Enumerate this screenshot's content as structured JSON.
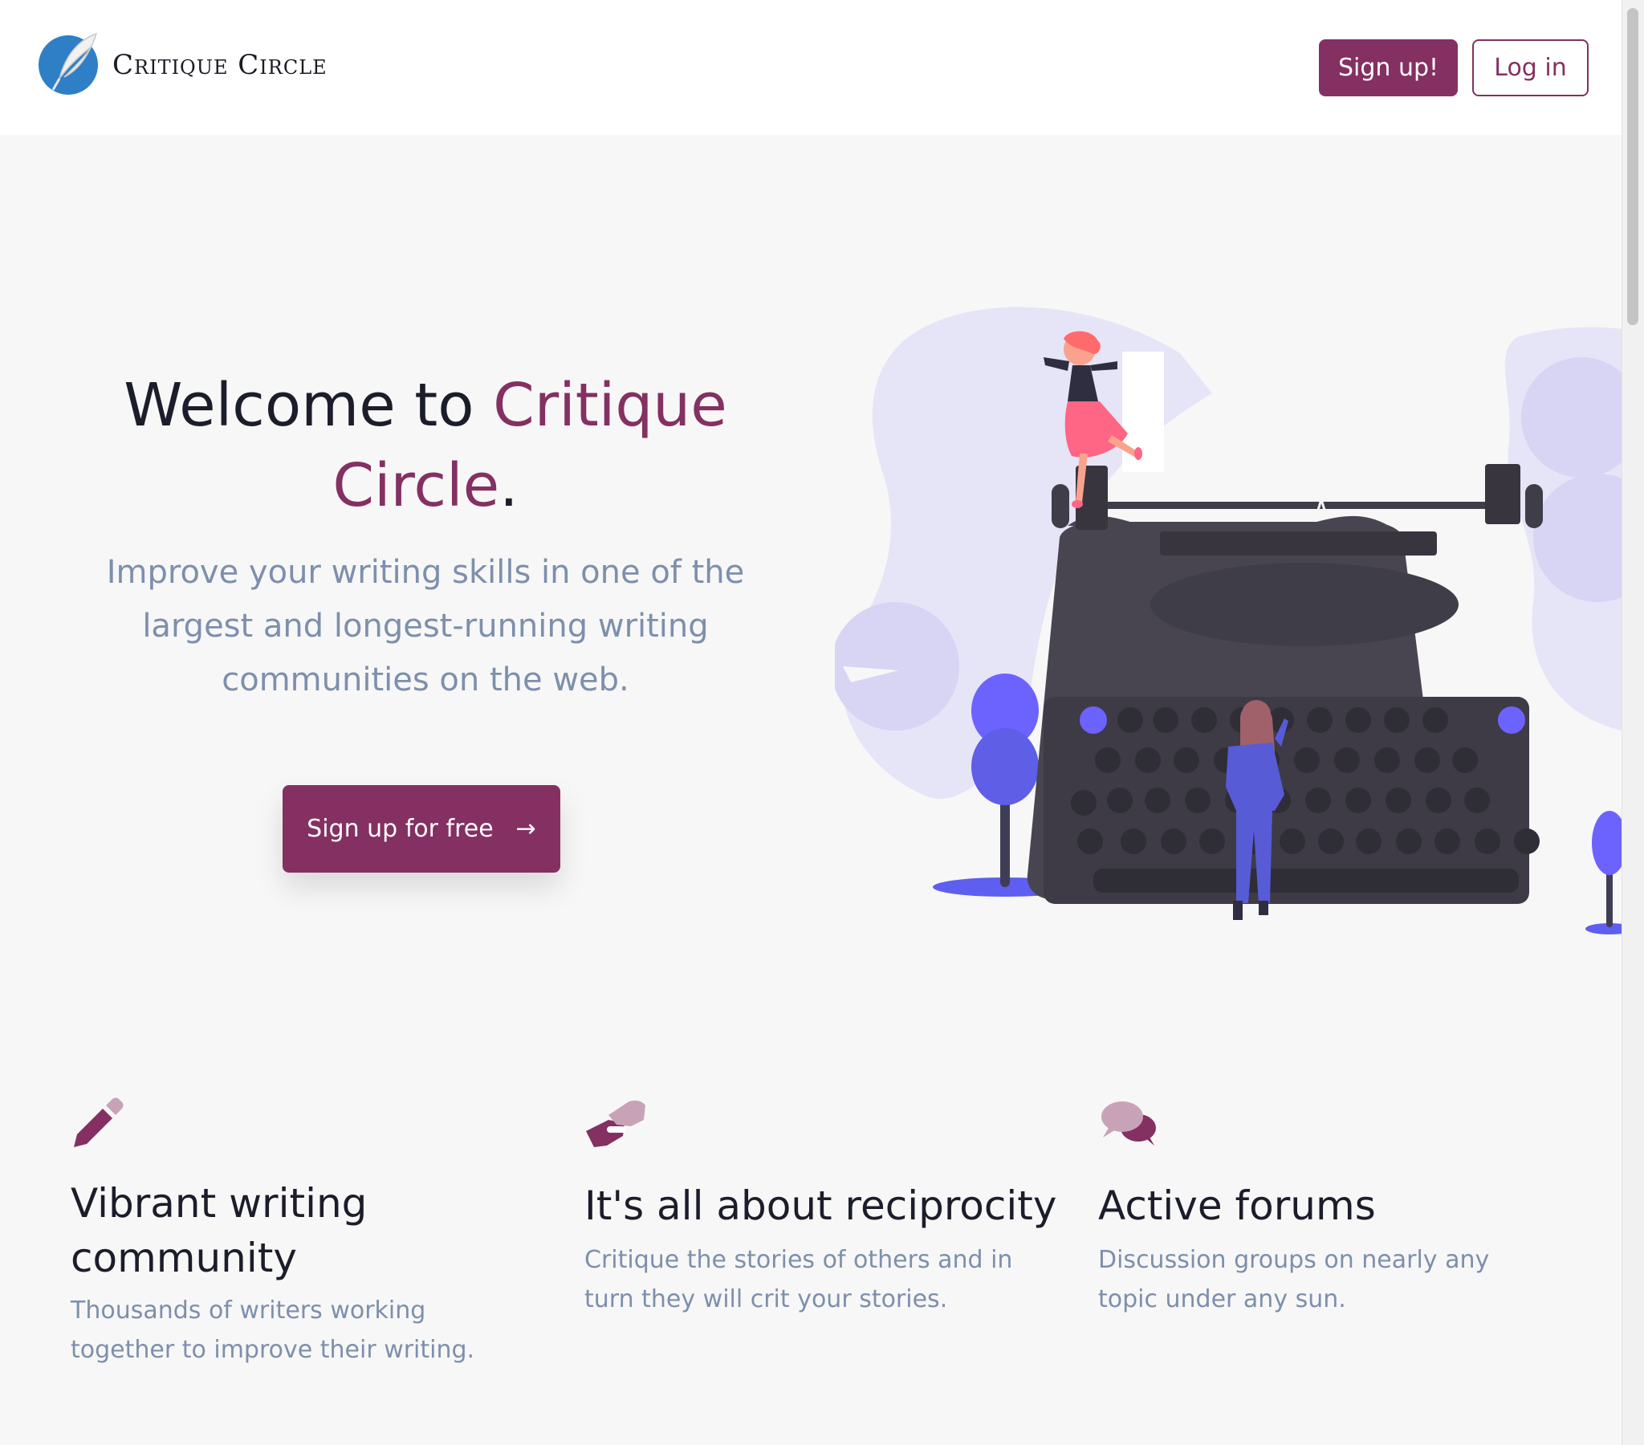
{
  "header": {
    "logo_text": "Critique Circle",
    "signup_label": "Sign up!",
    "login_label": "Log in"
  },
  "hero": {
    "title_plain": "Welcome to ",
    "title_accent": "Critique Circle",
    "title_end": ".",
    "subtitle": "Improve your writing skills in one of the largest and longest-running writing communities on the web.",
    "cta_label": "Sign up for free",
    "cta_arrow": "→"
  },
  "features": [
    {
      "icon": "pen-icon",
      "title": "Vibrant writing community",
      "text": "Thousands of writers working together to improve their writing."
    },
    {
      "icon": "handshake-icon",
      "title": "It's all about reciprocity",
      "text": "Critique the stories of others and in turn they will crit your stories."
    },
    {
      "icon": "chat-bubbles-icon",
      "title": "Active forums",
      "text": "Discussion groups on nearly any topic under any sun."
    }
  ],
  "colors": {
    "brand": "#843062",
    "muted_text": "#7d8fac",
    "dark_text": "#1c1d2b",
    "logo_blue": "#2f7fc6",
    "illustration_accent": "#6c63ff",
    "typewriter": "#484550"
  }
}
